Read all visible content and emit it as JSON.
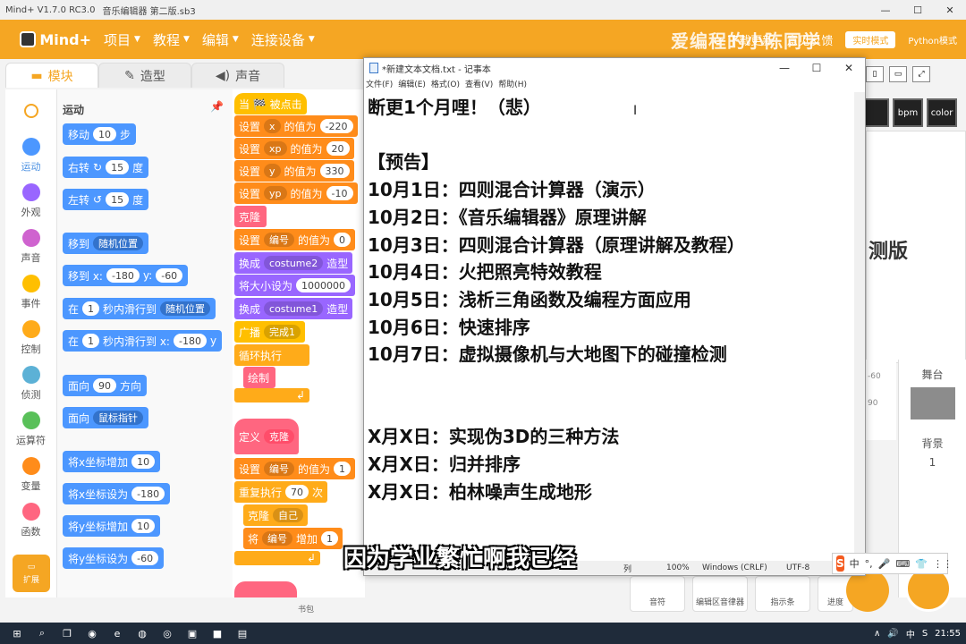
{
  "app": {
    "title": "Mind+ V1.7.0 RC3.0",
    "project": "音乐编辑器 第二版.sb3",
    "window_controls": [
      "—",
      "☐",
      "✕"
    ]
  },
  "menubar": {
    "logo": "Mind+",
    "items": [
      "项目",
      "教程",
      "编辑",
      "连接设备"
    ],
    "download": "下载更新",
    "feedback": "意见反馈",
    "mode_button": "实时模式",
    "python_label": "Python模式"
  },
  "watermark": "爱编程的小陈同学",
  "tabs": [
    "模块",
    "造型",
    "声音"
  ],
  "categories": [
    {
      "label": "运动",
      "color": "#4c97ff"
    },
    {
      "label": "外观",
      "color": "#9966ff"
    },
    {
      "label": "声音",
      "color": "#cf63cf"
    },
    {
      "label": "事件",
      "color": "#ffbf00"
    },
    {
      "label": "控制",
      "color": "#ffab19"
    },
    {
      "label": "侦测",
      "color": "#5cb1d6"
    },
    {
      "label": "运算符",
      "color": "#59c059"
    },
    {
      "label": "变量",
      "color": "#ff8c1a"
    },
    {
      "label": "函数",
      "color": "#ff6680"
    }
  ],
  "extend_label": "扩展",
  "palette": {
    "header": "运动",
    "blocks": {
      "move": {
        "pre": "移动",
        "val": "10",
        "post": "步"
      },
      "turn_right": {
        "pre": "右转",
        "icon": "↻",
        "val": "15",
        "post": "度"
      },
      "turn_left": {
        "pre": "左转",
        "icon": "↺",
        "val": "15",
        "post": "度"
      },
      "goto": {
        "pre": "移到",
        "dd": "随机位置"
      },
      "goto_xy": {
        "pre": "移到 x:",
        "x": "-180",
        "mid": "y:",
        "y": "-60"
      },
      "glide": {
        "pre": "在",
        "val": "1",
        "mid": "秒内滑行到",
        "dd": "随机位置"
      },
      "glide_xy": {
        "pre": "在",
        "val": "1",
        "mid": "秒内滑行到 x:",
        "x": "-180",
        "y": "y"
      },
      "point_dir": {
        "pre": "面向",
        "val": "90",
        "post": "方向"
      },
      "point_to": {
        "pre": "面向",
        "dd": "鼠标指针"
      },
      "change_x": {
        "pre": "将x坐标增加",
        "val": "10"
      },
      "set_x": {
        "pre": "将x坐标设为",
        "val": "-180"
      },
      "change_y": {
        "pre": "将y坐标增加",
        "val": "10"
      },
      "set_y": {
        "pre": "将y坐标设为",
        "val": "-60"
      }
    }
  },
  "script": {
    "hat": "当 🏁 被点击",
    "set_x": {
      "pre": "设置",
      "var": "x",
      "mid": "的值为",
      "val": "-220"
    },
    "set_xp": {
      "pre": "设置",
      "var": "xp",
      "mid": "的值为",
      "val": "20"
    },
    "set_y": {
      "pre": "设置",
      "var": "y",
      "mid": "的值为",
      "val": "330"
    },
    "set_yp": {
      "pre": "设置",
      "var": "yp",
      "mid": "的值为",
      "val": "-10"
    },
    "clone": "克隆",
    "set_num": {
      "pre": "设置",
      "var": "编号",
      "mid": "的值为",
      "val": "0"
    },
    "costume2": {
      "pre": "换成",
      "dd": "costume2",
      "post": "造型"
    },
    "size": {
      "pre": "将大小设为",
      "val": "1000000"
    },
    "costume1": {
      "pre": "换成",
      "dd": "costume1",
      "post": "造型"
    },
    "broadcast": {
      "pre": "广播",
      "dd": "完成1"
    },
    "forever": "循环执行",
    "draw": "绘制",
    "define": {
      "pre": "定义",
      "name": "克隆"
    },
    "set_num2": {
      "pre": "设置",
      "var": "编号",
      "mid": "的值为",
      "val": "1"
    },
    "repeat": {
      "pre": "重复执行",
      "val": "70",
      "post": "次"
    },
    "clone_self": {
      "pre": "克隆",
      "dd": "自己"
    },
    "change_num": {
      "pre": "将",
      "var": "编号",
      "mid": "增加",
      "val": "1"
    }
  },
  "notepad": {
    "title": "*新建文本文档.txt - 记事本",
    "menu": [
      "文件(F)",
      "编辑(E)",
      "格式(O)",
      "查看(V)",
      "帮助(H)"
    ],
    "lines": [
      "断更1个月哩！（悲）",
      "",
      "【预告】",
      "10月1日：四则混合计算器（演示）",
      "10月2日：《音乐编辑器》原理讲解",
      "10月3日：四则混合计算器（原理讲解及教程）",
      "10月4日：火把照亮特效教程",
      "10月5日：浅析三角函数及编程方面应用",
      "10月6日：快速排序",
      "10月7日：虚拟摄像机与大地图下的碰撞检测",
      "",
      "",
      "X月X日：实现伪3D的三种方法",
      "X月X日：归并排序",
      "X月X日：柏林噪声生成地形"
    ],
    "status": {
      "pos": "列",
      "zoom": "100%",
      "eol": "Windows (CRLF)",
      "enc": "UTF-8"
    }
  },
  "subtitle": "因为学业繁忙啊我已经",
  "stage": {
    "icons": [
      "",
      "bpm",
      "color"
    ],
    "canvas_text": "测版",
    "coords": [
      "-60",
      "90"
    ],
    "stage_label": "舞台",
    "backdrop_label": "背景",
    "backdrop_count": "1"
  },
  "bottom_tools": [
    "音符",
    "编辑区音律器",
    "指示条",
    "进度"
  ],
  "book_label": "书包",
  "ime": {
    "logo": "S",
    "items": [
      "中",
      "°,",
      "🎤",
      "⌨",
      "👕",
      "⋮⋮"
    ]
  },
  "taskbar": {
    "time": "21:55",
    "tray": [
      "∧",
      "🔊",
      "中",
      "S"
    ]
  }
}
